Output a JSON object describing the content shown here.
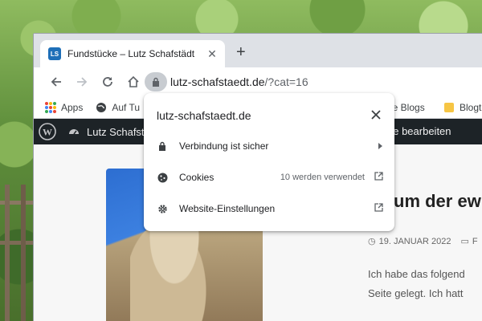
{
  "tab": {
    "favicon_text": "LS",
    "title": "Fundstücke – Lutz Schafstädt"
  },
  "omnibox": {
    "domain": "lutz-schafstaedt.de",
    "path": "/?cat=16"
  },
  "bookmarks": [
    {
      "label": "Apps",
      "icon": "apps-grid-icon"
    },
    {
      "label": "Auf Tu",
      "icon": "globe-icon"
    },
    {
      "label": "ne Blogs",
      "icon": "none"
    },
    {
      "label": "Blogt",
      "icon": "folder-icon"
    }
  ],
  "wpbar": {
    "site_label": "Lutz Schafstä",
    "edit_label": "ge bearbeiten"
  },
  "popup": {
    "site": "lutz-schafstaedt.de",
    "connection_label": "Verbindung ist sicher",
    "cookies_label": "Cookies",
    "cookies_count": "10 werden verwendet",
    "settings_label": "Website-Einstellungen"
  },
  "post": {
    "title": "um der ew",
    "date": "19. JANUAR 2022",
    "category_partial": "F",
    "line1": "Ich habe das folgend",
    "line2": "Seite gelegt. Ich hatt"
  },
  "colors": {
    "favicon": "#1e6fb8",
    "wp_admin_bar": "#1d2327",
    "tabstrip": "#dee1e6",
    "lock_chip": "#c8ccd1"
  }
}
